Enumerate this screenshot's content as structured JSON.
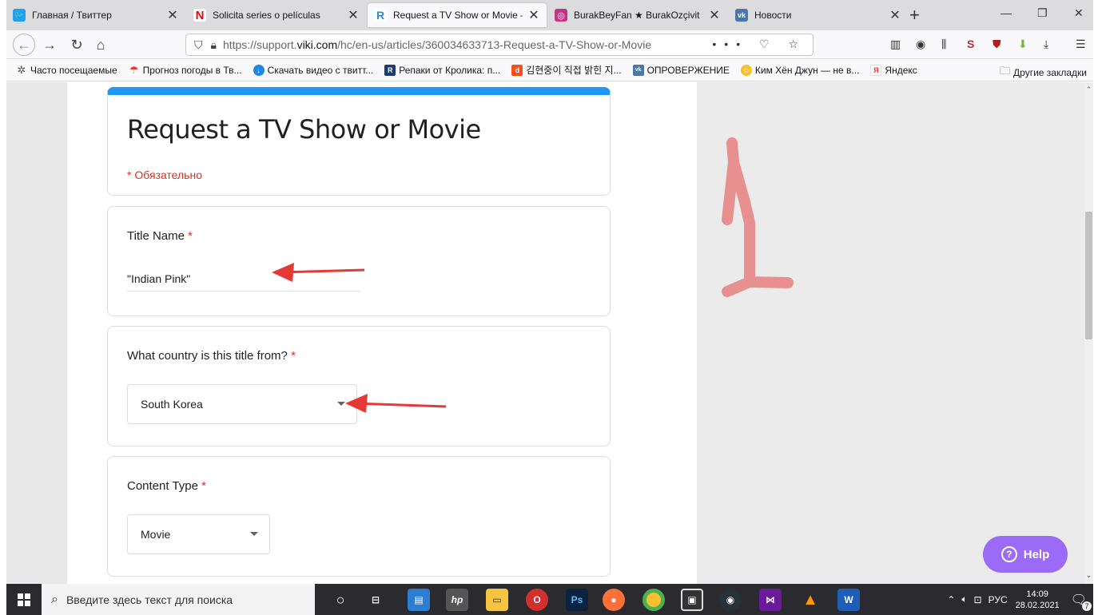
{
  "browser": {
    "tabs": [
      {
        "label": "Главная / Твиттер",
        "icon": "twitter-icon",
        "color": "#1da1f2",
        "glyph": "🐦"
      },
      {
        "label": "Solicita series o películas",
        "icon": "netflix-icon",
        "color": "#e50914",
        "glyph": "N"
      },
      {
        "label": "Request a TV Show or Movie – Vi",
        "icon": "viki-icon",
        "color": "#1e88e5",
        "glyph": "R"
      },
      {
        "label": "BurakBeyFan ★ BurakOzçivit ★",
        "icon": "instagram-icon",
        "color": "#c13584",
        "glyph": "◎"
      },
      {
        "label": "Новости",
        "icon": "vk-icon",
        "color": "#4a76a8",
        "glyph": "vk"
      }
    ],
    "url": {
      "prefix": "https://support.",
      "domain": "viki.com",
      "path": "/hc/en-us/articles/360034633713-Request-a-TV-Show-or-Movie"
    },
    "url_actions": "••• ♡ ☆",
    "bookmarks": [
      {
        "label": "Часто посещаемые",
        "icon": "gear-icon",
        "color": "#555"
      },
      {
        "label": "Прогноз погоды в Тв...",
        "icon": "umbrella-icon",
        "color": "#e53935"
      },
      {
        "label": "Скачать видео с твитт...",
        "icon": "download-icon",
        "color": "#1e88e5"
      },
      {
        "label": "Репаки от Кролика: п...",
        "icon": "rabbit-icon",
        "color": "#1c3a7a"
      },
      {
        "label": "김현중이 직접 밝힌 지...",
        "icon": "d-icon",
        "color": "#f4511e"
      },
      {
        "label": "ОПРОВЕРЖЕНИЕ",
        "icon": "vk-icon",
        "color": "#4a76a8"
      },
      {
        "label": "Ким Хён Джун — не в...",
        "icon": "smiley-icon",
        "color": "#fbc02d"
      },
      {
        "label": "Яндекс",
        "icon": "yandex-icon",
        "color": "#e53935"
      }
    ],
    "other_bookmarks": "Другие закладки"
  },
  "form": {
    "title": "Request a TV Show or Movie",
    "required_note": "* Обязательно",
    "q1": {
      "label": "Title Name",
      "star": "*",
      "answer": "\"Indian Pink\""
    },
    "q2": {
      "label": "What country is this title from?",
      "star": "*",
      "selected": "South Korea"
    },
    "q3": {
      "label": "Content Type",
      "star": "*",
      "selected": "Movie"
    }
  },
  "help": {
    "label": "Help"
  },
  "taskbar": {
    "search_placeholder": "Введите здесь текст для поиска",
    "lang": "РУС",
    "time": "14:09",
    "date": "28.02.2021",
    "notifications": "7"
  },
  "colors": {
    "accent": "#2196f3",
    "required": "#d93025",
    "help": "#9b6af7",
    "annotation": "#e53935",
    "drawing": "#e88f8f"
  }
}
